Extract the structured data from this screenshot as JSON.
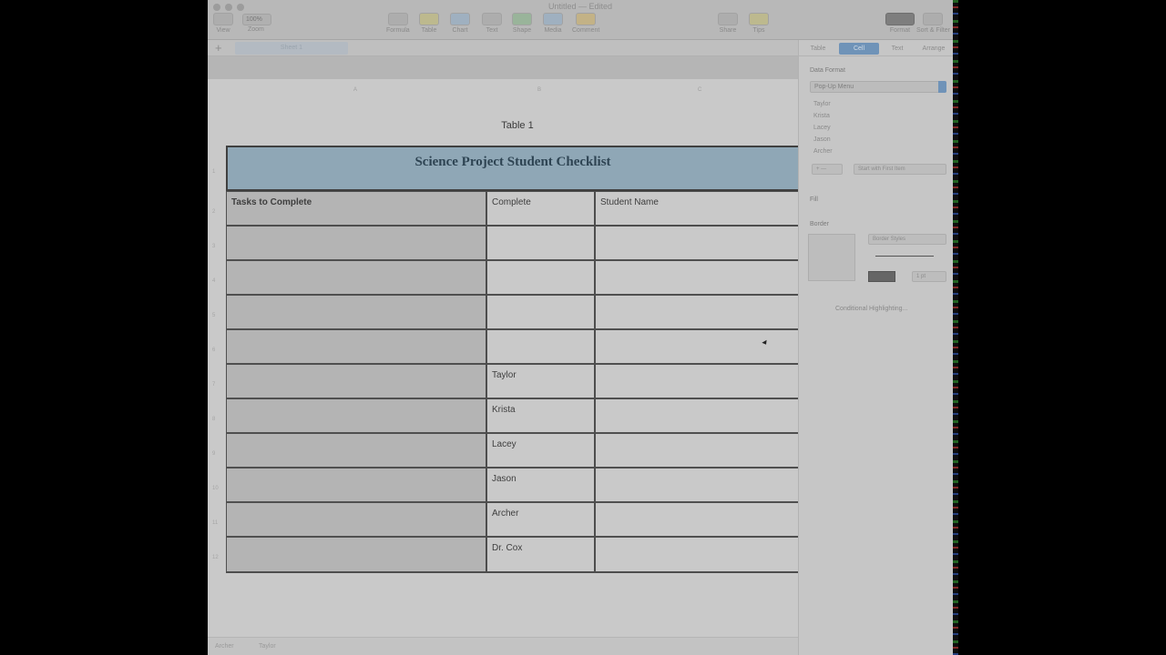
{
  "window": {
    "doc_title": "Untitled — Edited"
  },
  "toolbar": {
    "view_select": "100%",
    "items": [
      {
        "label": "View"
      },
      {
        "label": "Zoom"
      },
      {
        "label": "Formula"
      },
      {
        "label": "Table"
      },
      {
        "label": "Chart"
      },
      {
        "label": "Text"
      },
      {
        "label": "Shape"
      },
      {
        "label": "Media"
      },
      {
        "label": "Comment"
      },
      {
        "label": "Share"
      },
      {
        "label": "Tips"
      },
      {
        "label": "Format"
      },
      {
        "label": "Sort & Filter"
      }
    ]
  },
  "sheetbar": {
    "add_label": "+",
    "active_sheet": "Sheet 1"
  },
  "ruler": {
    "cols": [
      "A",
      "B",
      "C"
    ]
  },
  "table": {
    "title": "Table 1",
    "header": "Science Project Student Checklist",
    "columns": [
      "Tasks to Complete",
      "Complete",
      "Student Name"
    ],
    "rows": [
      {
        "complete": ""
      },
      {
        "complete": ""
      },
      {
        "complete": ""
      },
      {
        "complete": ""
      },
      {
        "complete": "Taylor"
      },
      {
        "complete": "Krista"
      },
      {
        "complete": "Lacey"
      },
      {
        "complete": "Jason"
      },
      {
        "complete": "Archer"
      },
      {
        "complete": "Dr. Cox"
      }
    ],
    "row_numbers": [
      "1",
      "2",
      "3",
      "4",
      "5",
      "6",
      "7",
      "8",
      "9",
      "10",
      "11",
      "12"
    ]
  },
  "inspector": {
    "tabs": [
      "Table",
      "Cell",
      "Text",
      "Arrange"
    ],
    "active_tab": "Cell",
    "data_format_label": "Data Format",
    "data_format_value": "Pop-Up Menu",
    "menu_items": [
      "Taylor",
      "Krista",
      "Lacey",
      "Jason",
      "Archer"
    ],
    "add_remove": "+ —",
    "start_with": "Start with First Item",
    "fill_label": "Fill",
    "border_label": "Border",
    "border_styles": "Border Styles",
    "border_width": "1 pt",
    "conditional": "Conditional Highlighting..."
  },
  "status_bar": {
    "left": "Archer",
    "right": "Taylor"
  },
  "colors": {
    "header_fill": "#8fa7b6",
    "accent": "#6f93b8"
  }
}
